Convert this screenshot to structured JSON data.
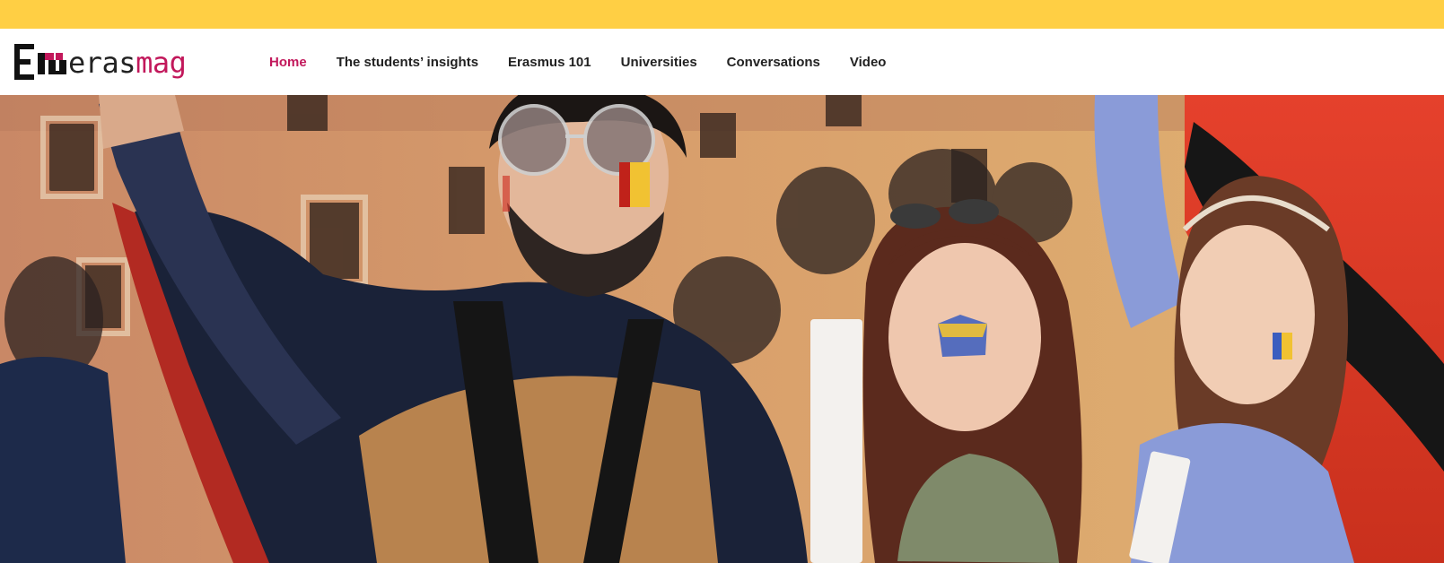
{
  "colors": {
    "top_bar": "#ffcf44",
    "accent": "#c2185b",
    "nav_text": "#222222",
    "header_bg": "#ffffff"
  },
  "logo": {
    "text_dark": "eras",
    "text_accent": "mag",
    "mark_icon": "erasmag-logo-mark"
  },
  "nav": {
    "items": [
      {
        "label": "Home",
        "active": true
      },
      {
        "label": "The students’ insights",
        "active": false
      },
      {
        "label": "Erasmus 101",
        "active": false
      },
      {
        "label": "Universities",
        "active": false
      },
      {
        "label": "Conversations",
        "active": false
      },
      {
        "label": "Video",
        "active": false
      }
    ]
  },
  "hero": {
    "image": "students-flag-demonstration-photo"
  }
}
